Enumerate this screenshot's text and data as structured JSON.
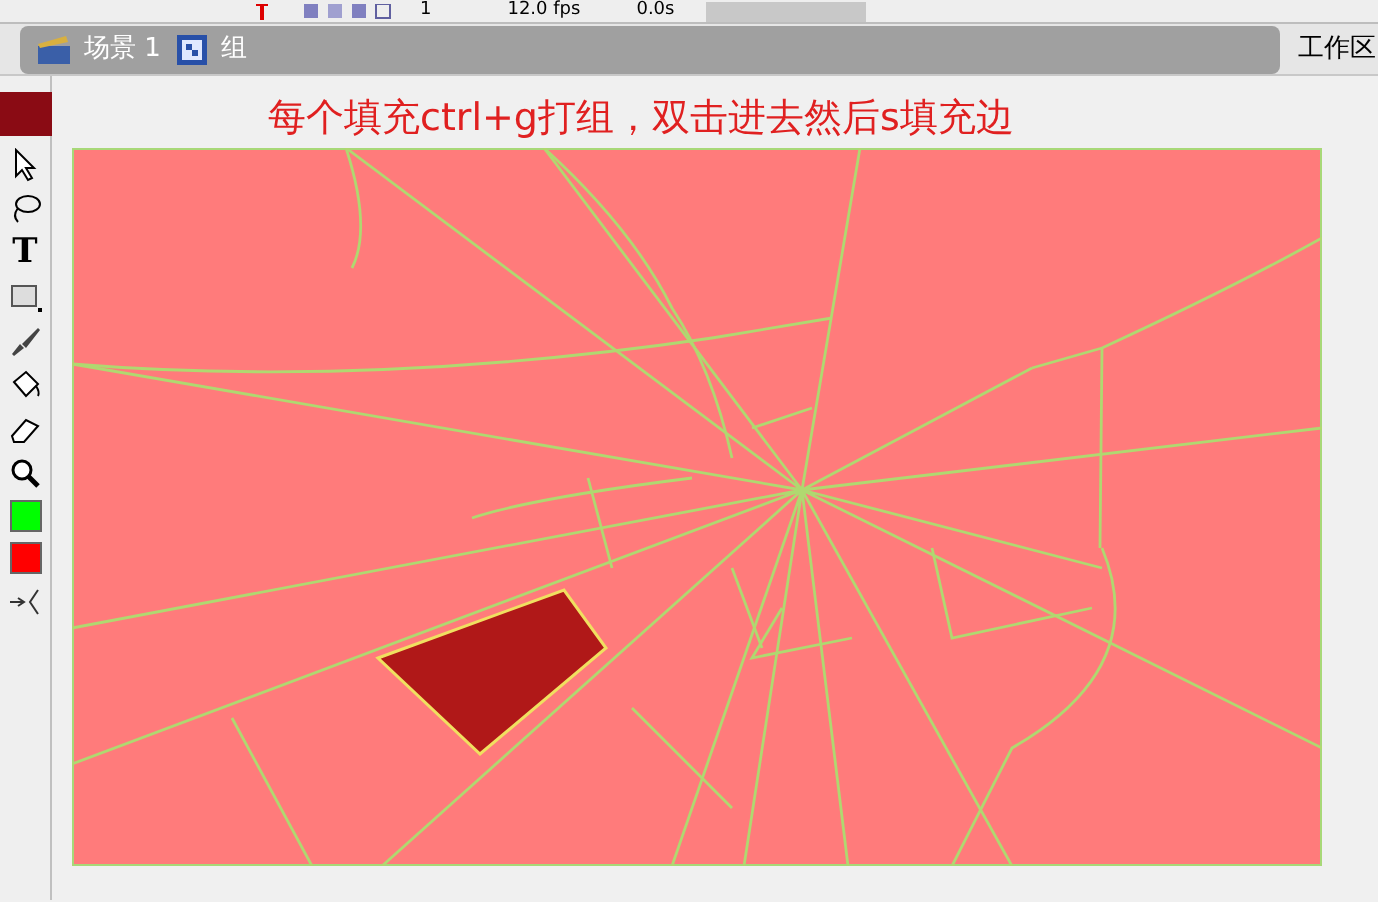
{
  "timeline": {
    "frame": "1",
    "fps": "12.0 fps",
    "time": "0.0s"
  },
  "breadcrumb": [
    {
      "label": "场景 1",
      "kind": "scene"
    },
    {
      "label": "组",
      "kind": "group"
    }
  ],
  "workspace_button": "工作区",
  "tools": [
    {
      "kind": "arrow"
    },
    {
      "kind": "lasso"
    },
    {
      "kind": "text",
      "label": "T"
    },
    {
      "kind": "rect"
    },
    {
      "kind": "brush"
    },
    {
      "kind": "bucket"
    },
    {
      "kind": "eraser"
    },
    {
      "kind": "zoom"
    },
    {
      "kind": "swatch",
      "color": "#00ff00"
    },
    {
      "kind": "swatch",
      "color": "#ff0000"
    },
    {
      "kind": "snap"
    }
  ],
  "annotation": "每个填充ctrl+g打组，双击进去然后s填充边"
}
